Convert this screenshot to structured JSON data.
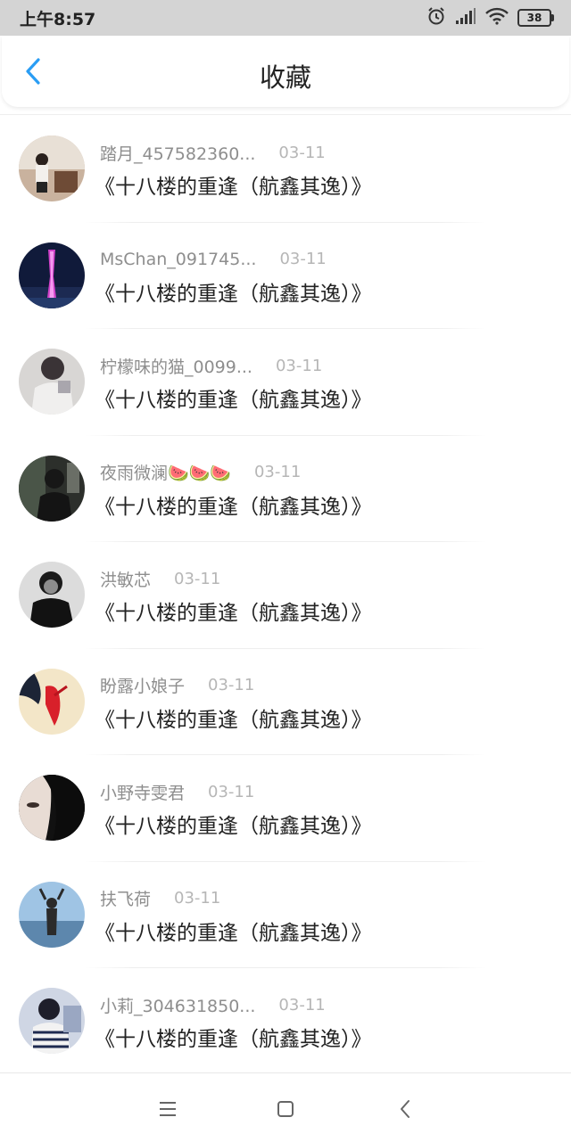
{
  "status_bar": {
    "time": "上午8:57",
    "battery": "38",
    "icons": [
      "alarm-icon",
      "signal-icon",
      "wifi-icon",
      "battery-icon"
    ]
  },
  "header": {
    "title": "收藏",
    "back_icon": "chevron-left-icon",
    "accent_color": "#2a9df4"
  },
  "items": [
    {
      "username": "踏月_457582360...",
      "date": "03-11",
      "title": "《十八楼的重逢（航鑫其逸）》",
      "avatar": "avatar-girl-room"
    },
    {
      "username": "MsChan_091745...",
      "date": "03-11",
      "title": "《十八楼的重逢（航鑫其逸）》",
      "avatar": "avatar-canton-tower"
    },
    {
      "username": "柠檬味的猫_0099...",
      "date": "03-11",
      "title": "《十八楼的重逢（航鑫其逸）》",
      "avatar": "avatar-girl-white"
    },
    {
      "username": "夜雨微澜🍉🍉🍉",
      "date": "03-11",
      "title": "《十八楼的重逢（航鑫其逸）》",
      "avatar": "avatar-boy-dark"
    },
    {
      "username": "洪敏芯",
      "date": "03-11",
      "title": "《十八楼的重逢（航鑫其逸）》",
      "avatar": "avatar-boy-jacket"
    },
    {
      "username": "盼露小娘子",
      "date": "03-11",
      "title": "《十八楼的重逢（航鑫其逸）》",
      "avatar": "avatar-red-art"
    },
    {
      "username": "小野寺雯君",
      "date": "03-11",
      "title": "《十八楼的重逢（航鑫其逸）》",
      "avatar": "avatar-face-dark"
    },
    {
      "username": "扶飞荷",
      "date": "03-11",
      "title": "《十八楼的重逢（航鑫其逸）》",
      "avatar": "avatar-sea-girl"
    },
    {
      "username": "小莉_304631850...",
      "date": "03-11",
      "title": "《十八楼的重逢（航鑫其逸）》",
      "avatar": "avatar-girl-striped"
    }
  ],
  "nav_bar": {
    "icons": [
      "menu-icon",
      "home-square-icon",
      "back-triangle-icon"
    ]
  }
}
